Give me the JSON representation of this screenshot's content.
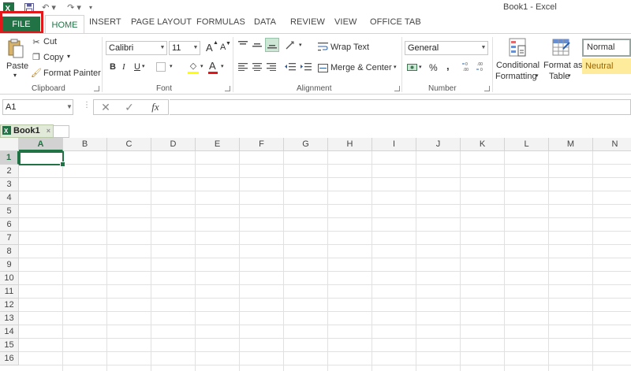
{
  "window": {
    "title": "Book1 - Excel"
  },
  "quick_access": {
    "excel_icon": "excel-logo",
    "save_icon": "save-icon",
    "undo_icon": "undo-icon",
    "redo_icon": "redo-icon"
  },
  "tabs": [
    {
      "label": "FILE"
    },
    {
      "label": "HOME"
    },
    {
      "label": "INSERT"
    },
    {
      "label": "PAGE LAYOUT"
    },
    {
      "label": "FORMULAS"
    },
    {
      "label": "DATA"
    },
    {
      "label": "REVIEW"
    },
    {
      "label": "VIEW"
    },
    {
      "label": "OFFICE TAB"
    }
  ],
  "clipboard": {
    "paste": "Paste",
    "cut": "Cut",
    "copy": "Copy",
    "format_painter": "Format Painter",
    "label": "Clipboard"
  },
  "font": {
    "name": "Calibri",
    "size": "11",
    "bold": "B",
    "italic": "I",
    "underline": "U",
    "grow": "A",
    "shrink": "A",
    "font_color": "A",
    "label": "Font",
    "accent_fill": "#ffff00",
    "accent_text": "#e3161a"
  },
  "alignment": {
    "wrap_text": "Wrap Text",
    "merge_center": "Merge & Center",
    "label": "Alignment"
  },
  "number": {
    "format": "General",
    "percent": "%",
    "comma": ",",
    "label": "Number"
  },
  "styles": {
    "conditional_line1": "Conditional",
    "conditional_line2": "Formatting",
    "format_table_line1": "Format as",
    "format_table_line2": "Table",
    "normal": "Normal",
    "neutral": "Neutral",
    "neutral_bg": "#ffeb9c"
  },
  "formula_bar": {
    "name_box": "A1",
    "fx": "fx",
    "value": ""
  },
  "workbook_tab": {
    "label": "Book1"
  },
  "grid": {
    "columns": [
      "A",
      "B",
      "C",
      "D",
      "E",
      "F",
      "G",
      "H",
      "I",
      "J",
      "K",
      "L",
      "M",
      "N"
    ],
    "rows": [
      "1",
      "2",
      "3",
      "4",
      "5",
      "6",
      "7",
      "8",
      "9",
      "10",
      "11",
      "12",
      "13",
      "14",
      "15",
      "16"
    ],
    "active_cell": "A1",
    "accent": "#217346"
  }
}
